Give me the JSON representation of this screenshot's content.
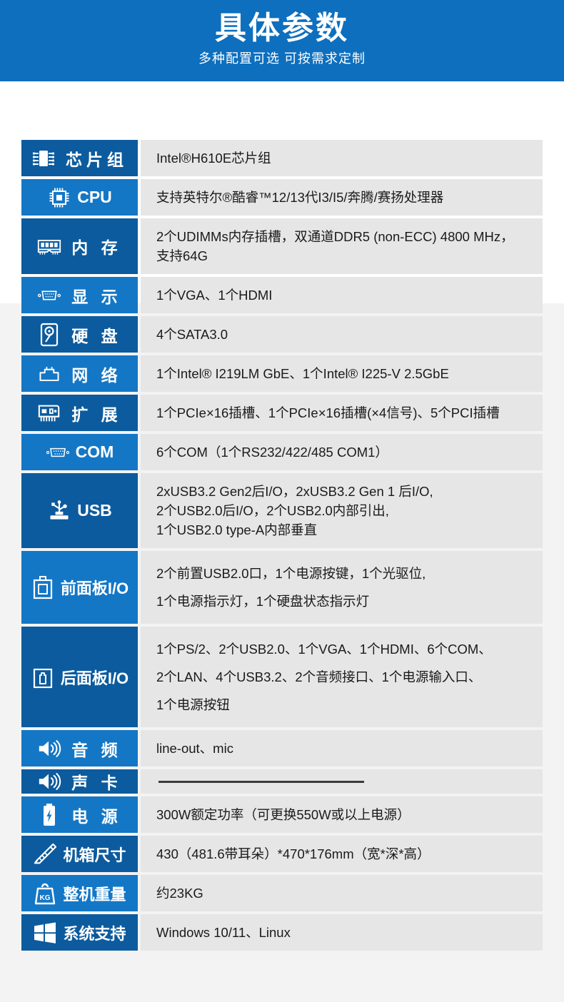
{
  "header": {
    "title": "具体参数",
    "subtitle": "多种配置可选 可按需求定制",
    "bg_color": "#0d6fbe"
  },
  "colors": {
    "label_dark": "#0c5b9e",
    "label_light": "#1477c6",
    "value_bg": "#e6e6e6",
    "page_bg": "#f3f3f3"
  },
  "spec_table": {
    "rows": [
      {
        "icon": "chipset-icon",
        "label": "芯片组",
        "lines": [
          "Intel®H610E芯片组"
        ]
      },
      {
        "icon": "cpu-icon",
        "label": "CPU",
        "lines": [
          "支持英特尔®酷睿™12/13代I3/I5/奔腾/赛扬处理器"
        ]
      },
      {
        "icon": "memory-icon",
        "label": "内 存",
        "lines": [
          "2个UDIMMs内存插槽，双通道DDR5 (non-ECC) 4800 MHz，",
          "支持64G"
        ]
      },
      {
        "icon": "vga-display-icon",
        "label": "显 示",
        "lines": [
          "1个VGA、1个HDMI"
        ]
      },
      {
        "icon": "harddisk-icon",
        "label": "硬 盘",
        "lines": [
          " 4个SATA3.0"
        ]
      },
      {
        "icon": "network-icon",
        "label": "网 络",
        "lines": [
          "1个Intel® I219LM GbE、1个Intel® I225-V 2.5GbE"
        ]
      },
      {
        "icon": "expansion-icon",
        "label": "扩 展",
        "lines": [
          "1个PCIe×16插槽、1个PCIe×16插槽(×4信号)、5个PCI插槽"
        ]
      },
      {
        "icon": "com-port-icon",
        "label": "COM",
        "lines": [
          "6个COM（1个RS232/422/485 COM1）"
        ]
      },
      {
        "icon": "usb-icon",
        "label": "USB",
        "lines": [
          "2xUSB3.2 Gen2后I/O，2xUSB3.2 Gen 1 后I/O,",
          "2个USB2.0后I/O，2个USB2.0内部引出,",
          "1个USB2.0 type-A内部垂直"
        ]
      },
      {
        "icon": "front-panel-icon",
        "label": "前面板I/O",
        "lines": [
          "2个前置USB2.0口，1个电源按键，1个光驱位,",
          "1个电源指示灯，1个硬盘状态指示灯"
        ]
      },
      {
        "icon": "rear-panel-icon",
        "label": "后面板I/O",
        "lines": [
          "1个PS/2、2个USB2.0、1个VGA、1个HDMI、6个COM、",
          "2个LAN、4个USB3.2、2个音频接口、1个电源输入口、",
          "1个电源按钮"
        ]
      },
      {
        "icon": "audio-icon",
        "label": "音 频",
        "lines": [
          "line-out、mic"
        ]
      },
      {
        "icon": "soundcard-icon",
        "label": "声 卡",
        "lines": [
          ""
        ]
      },
      {
        "icon": "power-icon",
        "label": "电 源",
        "lines": [
          "300W额定功率（可更换550W或以上电源）"
        ]
      },
      {
        "icon": "dimensions-icon",
        "label": "机箱尺寸",
        "lines": [
          "430（481.6带耳朵）*470*176mm（宽*深*高）"
        ]
      },
      {
        "icon": "weight-icon",
        "label": "整机重量",
        "lines": [
          "约23KG"
        ]
      },
      {
        "icon": "windows-icon",
        "label": "系统支持",
        "lines": [
          "Windows 10/11、Linux"
        ]
      }
    ]
  }
}
